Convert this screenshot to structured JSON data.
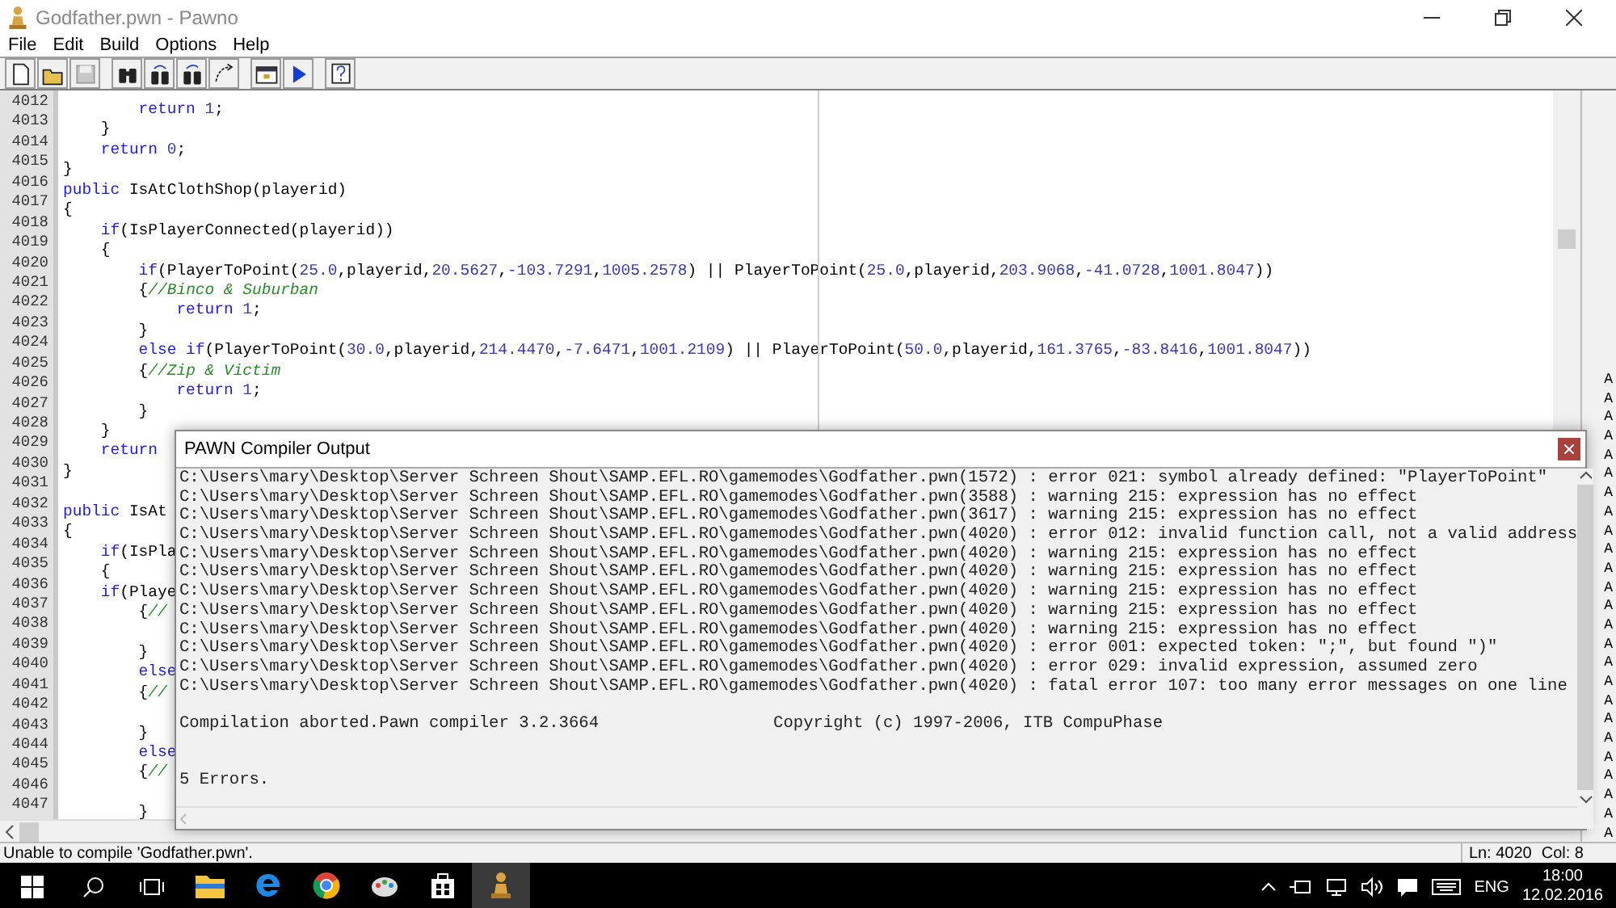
{
  "window": {
    "title": "Godfather.pwn - Pawno"
  },
  "menu": [
    "File",
    "Edit",
    "Build",
    "Options",
    "Help"
  ],
  "toolbar": [
    {
      "kind": "new",
      "disabled": false
    },
    {
      "kind": "open",
      "disabled": false
    },
    {
      "kind": "save",
      "disabled": true
    },
    {
      "kind": "find",
      "disabled": false
    },
    {
      "kind": "findnext",
      "disabled": false
    },
    {
      "kind": "replace",
      "disabled": false
    },
    {
      "kind": "goto",
      "disabled": false
    },
    {
      "kind": "window",
      "disabled": false
    },
    {
      "kind": "run",
      "disabled": false
    },
    {
      "kind": "help",
      "disabled": false
    }
  ],
  "editor": {
    "lines": [
      {
        "number": "4012",
        "tokens": [
          {
            "kind": "keyword",
            "text": "        return"
          },
          {
            "kind": "number",
            "text": " 1"
          },
          {
            "kind": "plain",
            "text": ";"
          }
        ]
      },
      {
        "number": "4013",
        "tokens": [
          {
            "kind": "plain",
            "text": "    }"
          }
        ]
      },
      {
        "number": "4014",
        "tokens": [
          {
            "kind": "keyword",
            "text": "    return"
          },
          {
            "kind": "number",
            "text": " 0"
          },
          {
            "kind": "plain",
            "text": ";"
          }
        ]
      },
      {
        "number": "4015",
        "tokens": [
          {
            "kind": "plain",
            "text": "}"
          }
        ]
      },
      {
        "number": "4016",
        "tokens": [
          {
            "kind": "keyword",
            "text": "public"
          },
          {
            "kind": "plain",
            "text": " IsAtClothShop(playerid)"
          }
        ]
      },
      {
        "number": "4017",
        "tokens": [
          {
            "kind": "plain",
            "text": "{"
          }
        ]
      },
      {
        "number": "4018",
        "tokens": [
          {
            "kind": "keyword",
            "text": "    if"
          },
          {
            "kind": "plain",
            "text": "(IsPlayerConnected(playerid))"
          }
        ]
      },
      {
        "number": "4019",
        "tokens": [
          {
            "kind": "plain",
            "text": "    {"
          }
        ]
      },
      {
        "number": "4020",
        "tokens": [
          {
            "kind": "keyword",
            "text": "        if"
          },
          {
            "kind": "plain",
            "text": "(PlayerToPoint("
          },
          {
            "kind": "number",
            "text": "25.0"
          },
          {
            "kind": "plain",
            "text": ",playerid,"
          },
          {
            "kind": "number",
            "text": "20.5627"
          },
          {
            "kind": "plain",
            "text": ","
          },
          {
            "kind": "number",
            "text": "-103.7291"
          },
          {
            "kind": "plain",
            "text": ","
          },
          {
            "kind": "number",
            "text": "1005.2578"
          },
          {
            "kind": "plain",
            "text": ") || PlayerToPoint("
          },
          {
            "kind": "number",
            "text": "25.0"
          },
          {
            "kind": "plain",
            "text": ",playerid,"
          },
          {
            "kind": "number",
            "text": "203.9068"
          },
          {
            "kind": "plain",
            "text": ","
          },
          {
            "kind": "number",
            "text": "-41.0728"
          },
          {
            "kind": "plain",
            "text": ","
          },
          {
            "kind": "number",
            "text": "1001.8047"
          },
          {
            "kind": "plain",
            "text": "))"
          }
        ]
      },
      {
        "number": "4021",
        "tokens": [
          {
            "kind": "plain",
            "text": "        {"
          },
          {
            "kind": "comment",
            "text": "//Binco & Suburban"
          }
        ]
      },
      {
        "number": "4022",
        "tokens": [
          {
            "kind": "keyword",
            "text": "            return"
          },
          {
            "kind": "number",
            "text": " 1"
          },
          {
            "kind": "plain",
            "text": ";"
          }
        ]
      },
      {
        "number": "4023",
        "tokens": [
          {
            "kind": "plain",
            "text": "        }"
          }
        ]
      },
      {
        "number": "4024",
        "tokens": [
          {
            "kind": "keyword",
            "text": "        else if"
          },
          {
            "kind": "plain",
            "text": "(PlayerToPoint("
          },
          {
            "kind": "number",
            "text": "30.0"
          },
          {
            "kind": "plain",
            "text": ",playerid,"
          },
          {
            "kind": "number",
            "text": "214.4470"
          },
          {
            "kind": "plain",
            "text": ","
          },
          {
            "kind": "number",
            "text": "-7.6471"
          },
          {
            "kind": "plain",
            "text": ","
          },
          {
            "kind": "number",
            "text": "1001.2109"
          },
          {
            "kind": "plain",
            "text": ") || PlayerToPoint("
          },
          {
            "kind": "number",
            "text": "50.0"
          },
          {
            "kind": "plain",
            "text": ",playerid,"
          },
          {
            "kind": "number",
            "text": "161.3765"
          },
          {
            "kind": "plain",
            "text": ","
          },
          {
            "kind": "number",
            "text": "-83.8416"
          },
          {
            "kind": "plain",
            "text": ","
          },
          {
            "kind": "number",
            "text": "1001.8047"
          },
          {
            "kind": "plain",
            "text": "))"
          }
        ]
      },
      {
        "number": "4025",
        "tokens": [
          {
            "kind": "plain",
            "text": "        {"
          },
          {
            "kind": "comment",
            "text": "//Zip & Victim"
          }
        ]
      },
      {
        "number": "4026",
        "tokens": [
          {
            "kind": "keyword",
            "text": "            return"
          },
          {
            "kind": "number",
            "text": " 1"
          },
          {
            "kind": "plain",
            "text": ";"
          }
        ]
      },
      {
        "number": "4027",
        "tokens": [
          {
            "kind": "plain",
            "text": "        }"
          }
        ]
      },
      {
        "number": "4028",
        "tokens": [
          {
            "kind": "plain",
            "text": "    }"
          }
        ]
      },
      {
        "number": "4029",
        "tokens": [
          {
            "kind": "keyword",
            "text": "    return"
          }
        ]
      },
      {
        "number": "4030",
        "tokens": [
          {
            "kind": "plain",
            "text": "}"
          }
        ]
      },
      {
        "number": "4031"
      },
      {
        "number": "4032",
        "tokens": [
          {
            "kind": "keyword",
            "text": "public"
          },
          {
            "kind": "plain",
            "text": " IsAt"
          }
        ]
      },
      {
        "number": "4033",
        "tokens": [
          {
            "kind": "plain",
            "text": "{"
          }
        ]
      },
      {
        "number": "4034",
        "tokens": [
          {
            "kind": "keyword",
            "text": "    if"
          },
          {
            "kind": "plain",
            "text": "(IsPla"
          }
        ]
      },
      {
        "number": "4035",
        "tokens": [
          {
            "kind": "plain",
            "text": "    {"
          }
        ]
      },
      {
        "number": "4036",
        "tokens": [
          {
            "kind": "keyword",
            "text": "    if"
          },
          {
            "kind": "plain",
            "text": "(Playe"
          }
        ]
      },
      {
        "number": "4037",
        "tokens": [
          {
            "kind": "plain",
            "text": "        {"
          },
          {
            "kind": "comment",
            "text": "//"
          }
        ]
      },
      {
        "number": "4038"
      },
      {
        "number": "4039",
        "tokens": [
          {
            "kind": "plain",
            "text": "        }"
          }
        ]
      },
      {
        "number": "4040",
        "tokens": [
          {
            "kind": "keyword",
            "text": "        else"
          }
        ]
      },
      {
        "number": "4041",
        "tokens": [
          {
            "kind": "plain",
            "text": "        {"
          },
          {
            "kind": "comment",
            "text": "//"
          }
        ]
      },
      {
        "number": "4042"
      },
      {
        "number": "4043",
        "tokens": [
          {
            "kind": "plain",
            "text": "        }"
          }
        ]
      },
      {
        "number": "4044",
        "tokens": [
          {
            "kind": "keyword",
            "text": "        else"
          }
        ]
      },
      {
        "number": "4045",
        "tokens": [
          {
            "kind": "plain",
            "text": "        {"
          },
          {
            "kind": "comment",
            "text": "//"
          }
        ]
      },
      {
        "number": "4046"
      },
      {
        "number": "4047",
        "tokens": [
          {
            "kind": "plain",
            "text": "        }"
          }
        ]
      }
    ]
  },
  "right_edge_letters": [
    "A",
    "A",
    "A",
    "A",
    "A",
    "A",
    "A",
    "A",
    "A",
    "A",
    "A",
    "A",
    "A",
    "A",
    "A",
    "A",
    "A",
    "A",
    "A",
    "A",
    "A",
    "A",
    "A",
    "A",
    "A"
  ],
  "compiler_output": {
    "title": "PAWN Compiler Output",
    "lines": [
      "C:\\Users\\mary\\Desktop\\Server Schreen Shout\\SAMP.EFL.RO\\gamemodes\\Godfather.pwn(1572) : error 021: symbol already defined: \"PlayerToPoint\"",
      "C:\\Users\\mary\\Desktop\\Server Schreen Shout\\SAMP.EFL.RO\\gamemodes\\Godfather.pwn(3588) : warning 215: expression has no effect",
      "C:\\Users\\mary\\Desktop\\Server Schreen Shout\\SAMP.EFL.RO\\gamemodes\\Godfather.pwn(3617) : warning 215: expression has no effect",
      "C:\\Users\\mary\\Desktop\\Server Schreen Shout\\SAMP.EFL.RO\\gamemodes\\Godfather.pwn(4020) : error 012: invalid function call, not a valid address",
      "C:\\Users\\mary\\Desktop\\Server Schreen Shout\\SAMP.EFL.RO\\gamemodes\\Godfather.pwn(4020) : warning 215: expression has no effect",
      "C:\\Users\\mary\\Desktop\\Server Schreen Shout\\SAMP.EFL.RO\\gamemodes\\Godfather.pwn(4020) : warning 215: expression has no effect",
      "C:\\Users\\mary\\Desktop\\Server Schreen Shout\\SAMP.EFL.RO\\gamemodes\\Godfather.pwn(4020) : warning 215: expression has no effect",
      "C:\\Users\\mary\\Desktop\\Server Schreen Shout\\SAMP.EFL.RO\\gamemodes\\Godfather.pwn(4020) : warning 215: expression has no effect",
      "C:\\Users\\mary\\Desktop\\Server Schreen Shout\\SAMP.EFL.RO\\gamemodes\\Godfather.pwn(4020) : warning 215: expression has no effect",
      "C:\\Users\\mary\\Desktop\\Server Schreen Shout\\SAMP.EFL.RO\\gamemodes\\Godfather.pwn(4020) : error 001: expected token: \";\", but found \")\"",
      "C:\\Users\\mary\\Desktop\\Server Schreen Shout\\SAMP.EFL.RO\\gamemodes\\Godfather.pwn(4020) : error 029: invalid expression, assumed zero",
      "C:\\Users\\mary\\Desktop\\Server Schreen Shout\\SAMP.EFL.RO\\gamemodes\\Godfather.pwn(4020) : fatal error 107: too many error messages on one line"
    ],
    "summary": "Compilation aborted.Pawn compiler 3.2.3664",
    "copyright": "Copyright (c) 1997-2006, ITB CompuPhase",
    "errors": "5 Errors."
  },
  "status_bar": {
    "message": "Unable to compile 'Godfather.pwn'.",
    "line": "Ln: 4020",
    "column": "Col: 8"
  },
  "taskbar": {
    "apps": [
      {
        "kind": "explorer",
        "selected": false
      },
      {
        "kind": "edge",
        "selected": false
      },
      {
        "kind": "chrome",
        "selected": false
      },
      {
        "kind": "paint",
        "selected": false
      },
      {
        "kind": "store",
        "selected": false
      },
      {
        "kind": "pawno",
        "selected": true
      }
    ],
    "language": "ENG",
    "time": "18:00",
    "date": "12.02.2016"
  }
}
